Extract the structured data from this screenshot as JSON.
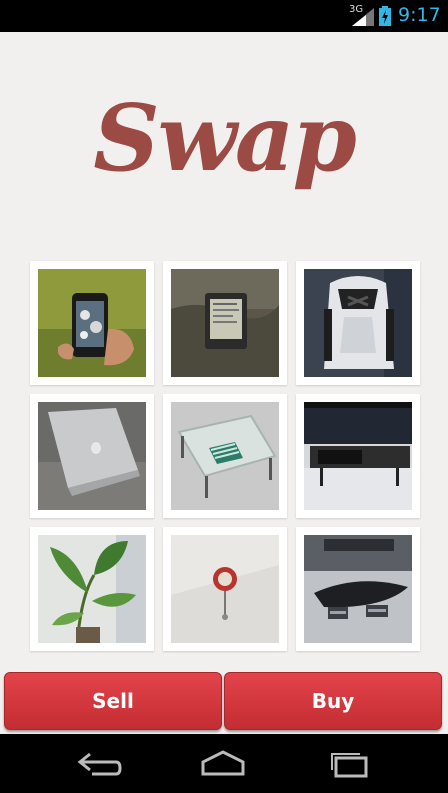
{
  "status_bar": {
    "network": "3G",
    "time": "9:17"
  },
  "app": {
    "logo": "Swap"
  },
  "grid": {
    "items": [
      {
        "name": "iphone"
      },
      {
        "name": "kindle"
      },
      {
        "name": "backpack"
      },
      {
        "name": "macbook"
      },
      {
        "name": "glass-table"
      },
      {
        "name": "tv"
      },
      {
        "name": "plant"
      },
      {
        "name": "wall-clock"
      },
      {
        "name": "coffee-table"
      }
    ]
  },
  "actions": {
    "sell_label": "Sell",
    "buy_label": "Buy"
  },
  "colors": {
    "logo": "#9b4a44",
    "button": "#d93a40",
    "status_accent": "#33b5e5"
  }
}
